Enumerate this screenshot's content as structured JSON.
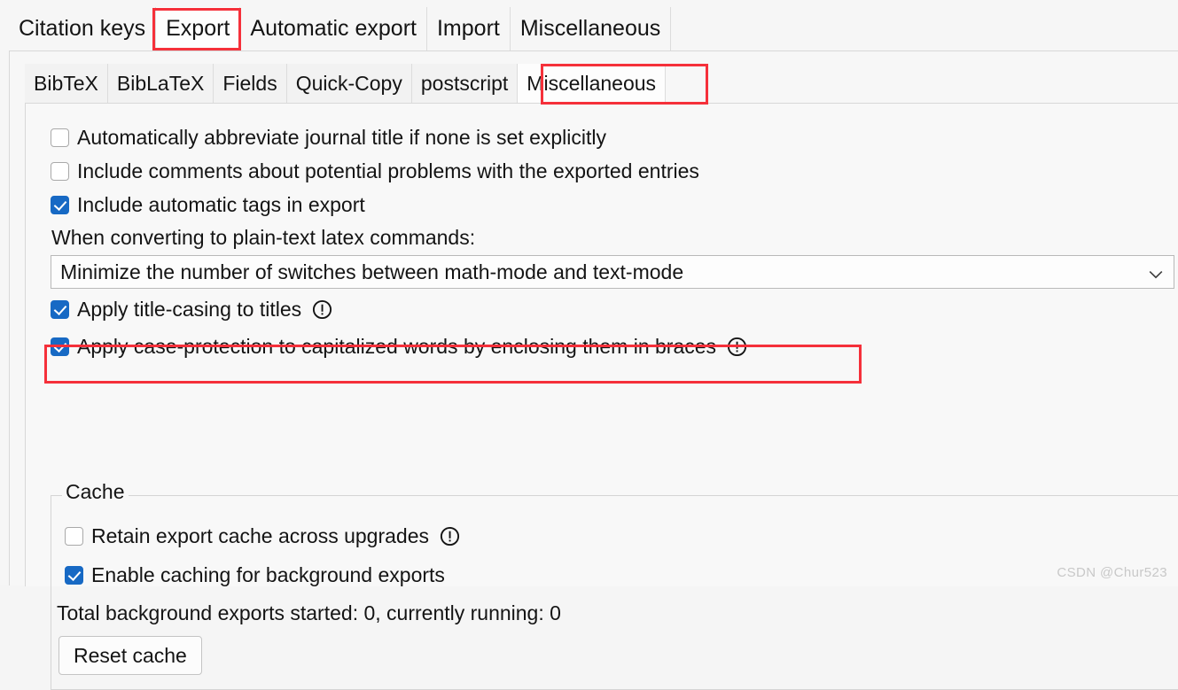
{
  "outer_tabs": [
    {
      "label": "Citation keys",
      "selected": false
    },
    {
      "label": "Export",
      "selected": true
    },
    {
      "label": "Automatic export",
      "selected": false
    },
    {
      "label": "Import",
      "selected": false
    },
    {
      "label": "Miscellaneous",
      "selected": false
    }
  ],
  "inner_tabs": [
    {
      "label": "BibTeX",
      "selected": false
    },
    {
      "label": "BibLaTeX",
      "selected": false
    },
    {
      "label": "Fields",
      "selected": false
    },
    {
      "label": "Quick-Copy",
      "selected": false
    },
    {
      "label": "postscript",
      "selected": false
    },
    {
      "label": "Miscellaneous",
      "selected": true
    }
  ],
  "options": {
    "abbreviate_journal": {
      "label": "Automatically abbreviate journal title if none is set explicitly",
      "checked": false
    },
    "include_comments": {
      "label": "Include comments about potential problems with the exported entries",
      "checked": false
    },
    "include_auto_tags": {
      "label": "Include automatic tags in export",
      "checked": true
    },
    "latex_commands_label": "When converting to plain-text latex commands:",
    "latex_commands_select": {
      "value": "Minimize the number of switches between math-mode and text-mode"
    },
    "title_casing": {
      "label": "Apply title-casing to titles",
      "checked": true,
      "has_info": true
    },
    "case_protection": {
      "label": "Apply case-protection to capitalized words by enclosing them in braces",
      "checked": true,
      "has_info": true
    }
  },
  "cache": {
    "legend": "Cache",
    "retain_cache": {
      "label": "Retain export cache across upgrades",
      "checked": false,
      "has_info": true
    },
    "enable_caching": {
      "label": "Enable caching for background exports",
      "checked": true
    },
    "status": "Total background exports started: 0, currently running: 0",
    "reset_button": "Reset cache"
  },
  "annotations": {
    "highlight_color": "#f5303a",
    "boxes": [
      "export-tab",
      "miscellaneous-inner-tab",
      "case-protection-row"
    ]
  },
  "watermark": "CSDN @Chur523"
}
